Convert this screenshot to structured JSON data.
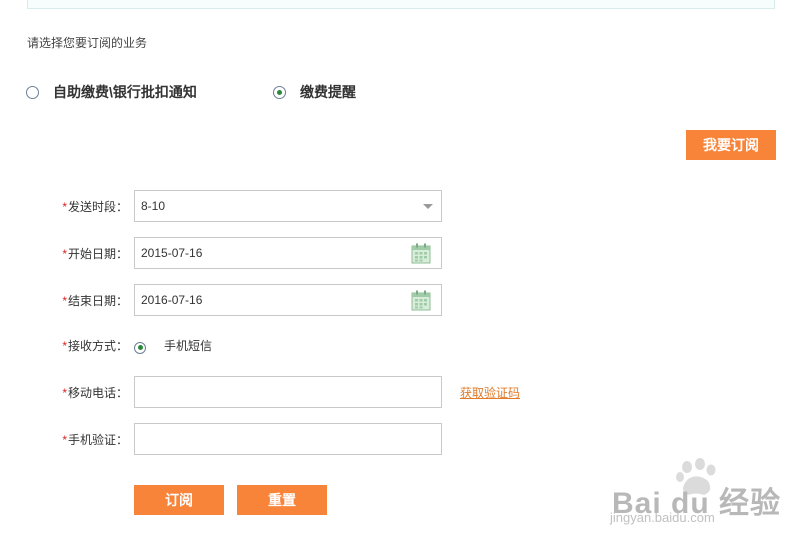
{
  "prompt": "请选择您要订阅的业务",
  "services": [
    {
      "label": "自助缴费\\银行批扣通知",
      "selected": false
    },
    {
      "label": "缴费提醒",
      "selected": true
    }
  ],
  "subscribe_button": "我要订阅",
  "form": {
    "required_mark": "*",
    "send_period": {
      "label": "发送时段：",
      "value": "8-10"
    },
    "start_date": {
      "label": "开始日期：",
      "value": "2015-07-16"
    },
    "end_date": {
      "label": "结束日期：",
      "value": "2016-07-16"
    },
    "receive_method": {
      "label": "接收方式：",
      "option": "手机短信",
      "selected": true
    },
    "mobile_phone": {
      "label": "移动电话：",
      "value": "",
      "get_code_link": "获取验证码"
    },
    "sms_code": {
      "label": "手机验证：",
      "value": ""
    }
  },
  "buttons": {
    "ok": "订阅",
    "reset": "重置"
  },
  "watermark": {
    "brand": "Bai du 经验",
    "url": "jingyan.baidu.com"
  },
  "colors": {
    "accent": "#f8843a",
    "required": "#e02020",
    "link": "#e07b2a"
  }
}
